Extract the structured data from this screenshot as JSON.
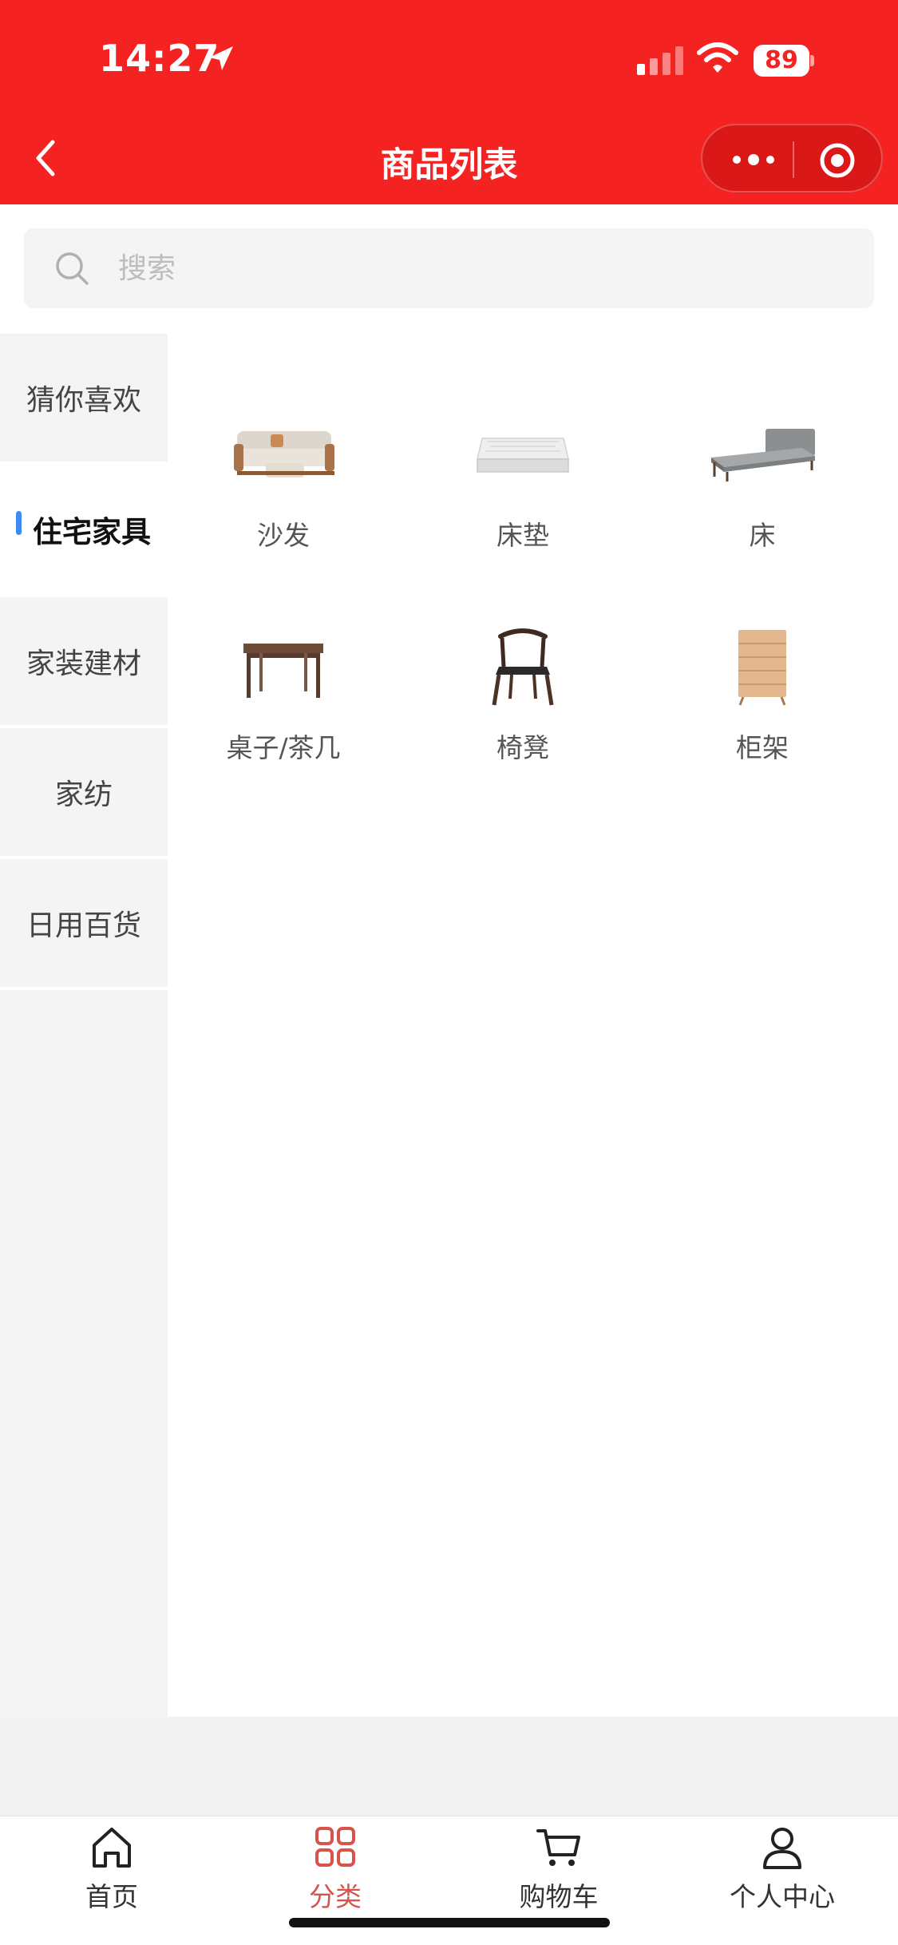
{
  "status": {
    "time": "14:27",
    "battery": "89"
  },
  "nav": {
    "title": "商品列表"
  },
  "search": {
    "placeholder": "搜索"
  },
  "sidebar": {
    "items": [
      {
        "label": "猜你喜欢"
      },
      {
        "label": "住宅家具"
      },
      {
        "label": "家装建材"
      },
      {
        "label": "家纺"
      },
      {
        "label": "日用百货"
      }
    ],
    "active_index": 1
  },
  "products": [
    {
      "label": "沙发",
      "icon": "sofa-icon"
    },
    {
      "label": "床垫",
      "icon": "mattress-icon"
    },
    {
      "label": "床",
      "icon": "bed-icon"
    },
    {
      "label": "桌子/茶几",
      "icon": "table-icon"
    },
    {
      "label": "椅凳",
      "icon": "chair-icon"
    },
    {
      "label": "柜架",
      "icon": "cabinet-icon"
    }
  ],
  "tabbar": {
    "items": [
      {
        "label": "首页",
        "icon": "home-icon"
      },
      {
        "label": "分类",
        "icon": "category-icon"
      },
      {
        "label": "购物车",
        "icon": "cart-icon"
      },
      {
        "label": "个人中心",
        "icon": "user-icon"
      }
    ],
    "active_index": 1
  },
  "colors": {
    "header": "#f52222",
    "active_tab": "#d9534a",
    "active_indicator": "#3d8bf0"
  }
}
